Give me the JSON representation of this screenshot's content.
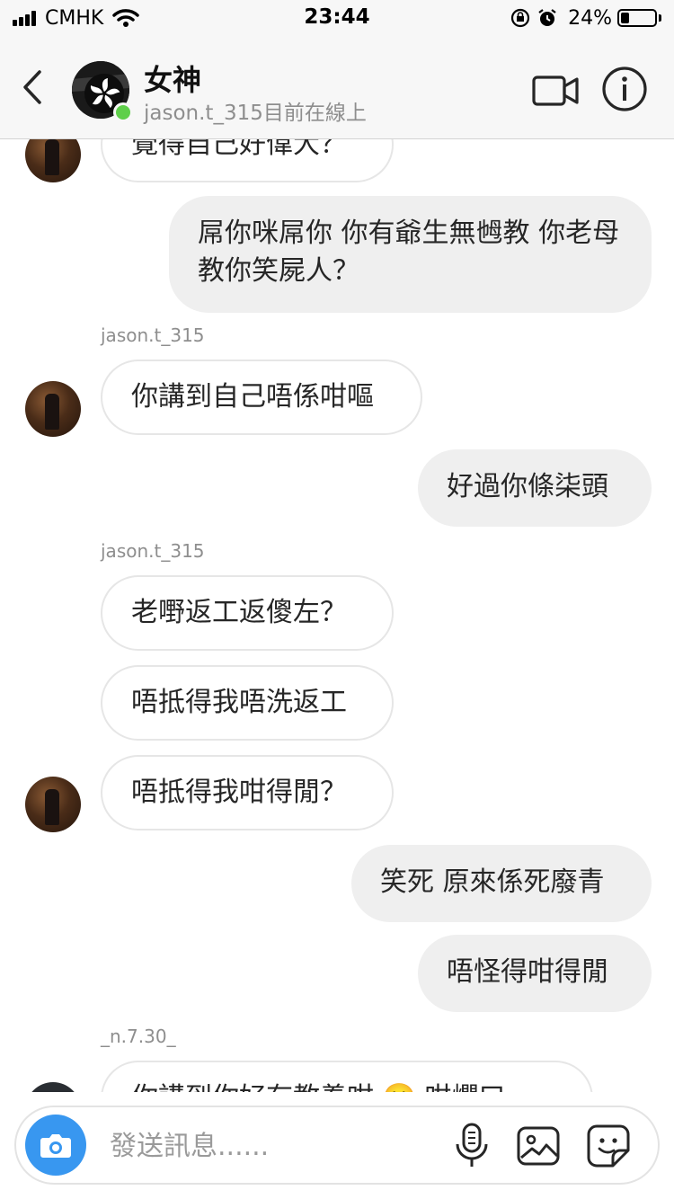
{
  "status_bar": {
    "carrier": "CMHK",
    "time": "23:44",
    "battery_percent": "24%",
    "battery_level": 0.24
  },
  "header": {
    "title": "女神",
    "subtitle": "jason.t_315目前在線上",
    "back_icon": "chevron-left-icon",
    "video_icon": "video-camera-icon",
    "info_icon": "info-icon"
  },
  "messages": [
    {
      "side": "in",
      "text": "覺得自己好偉大？"
    },
    {
      "side": "out",
      "text": "屌你咪屌你 你有爺生無乸教 你老母教你笑屍人？"
    },
    {
      "sender": "jason.t_315"
    },
    {
      "side": "in",
      "text": "你講到自己唔係咁嘔"
    },
    {
      "side": "out",
      "text": "好過你條柒頭"
    },
    {
      "sender": "jason.t_315"
    },
    {
      "side": "in",
      "text": "老嘢返工返傻左？"
    },
    {
      "side": "in",
      "text": "唔抵得我唔洗返工"
    },
    {
      "side": "in",
      "text": "唔抵得我咁得閒？"
    },
    {
      "side": "out",
      "text": "笑死 原來係死廢青"
    },
    {
      "side": "out",
      "text": "唔怪得咁得閒"
    },
    {
      "sender": "_n.7.30_"
    },
    {
      "side": "in",
      "text": "你講到你好有教養咁 🙂 咁爛口"
    }
  ],
  "composer": {
    "placeholder": "發送訊息......",
    "camera_icon": "camera-icon",
    "mic_icon": "microphone-icon",
    "gallery_icon": "image-icon",
    "sticker_icon": "sticker-icon"
  },
  "colors": {
    "accent": "#3897f0",
    "online": "#5fcf4a",
    "outgoing_bubble": "#efefef",
    "secondary_text": "#8e8e8e"
  }
}
